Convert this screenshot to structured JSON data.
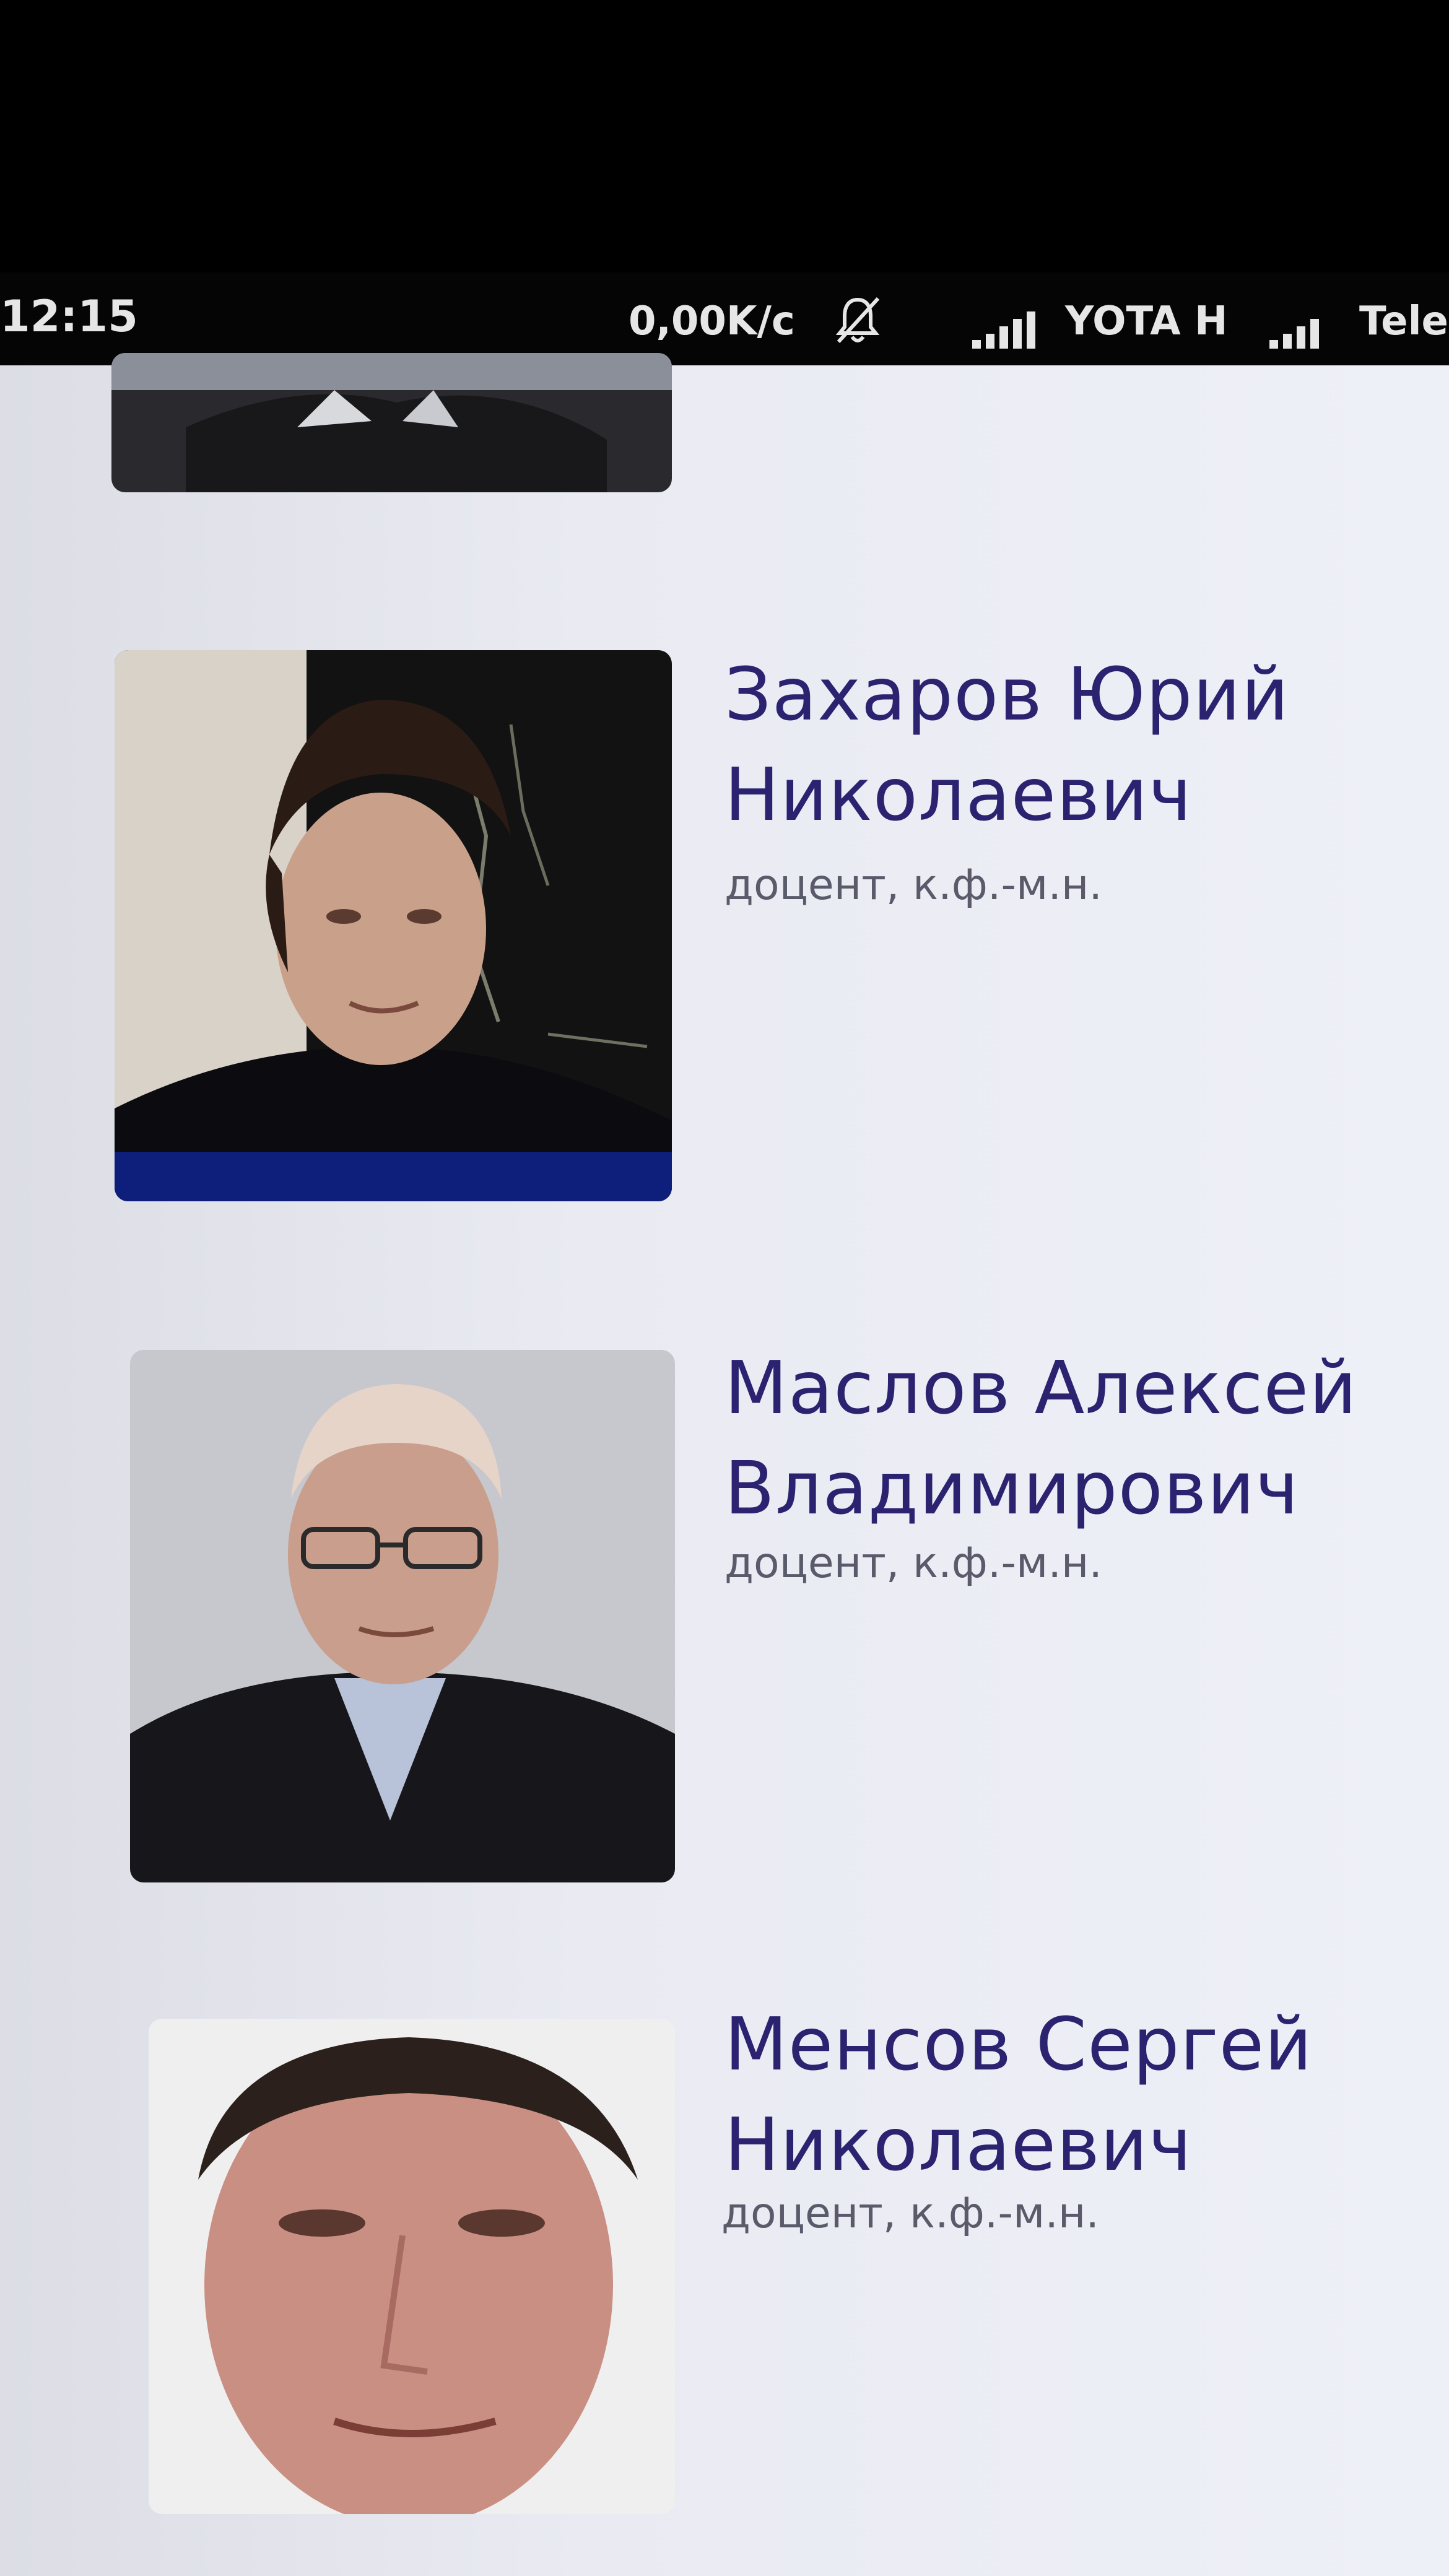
{
  "status_bar": {
    "time": "12:15",
    "net_speed": "0,00K/c",
    "notifications_icon": "bell-off-icon",
    "signal_icon": "signal-bars-icon",
    "carrier_1": "YOTA H",
    "carrier_2": "Tele"
  },
  "staff": [
    {
      "name_line1": "",
      "name_line2": "",
      "title": "",
      "photo": "person-photo"
    },
    {
      "name_line1": "Захаров Юрий",
      "name_line2": "Николаевич",
      "title": "доцент, к.ф.-м.н.",
      "photo": "person-photo"
    },
    {
      "name_line1": "Маслов Алексей",
      "name_line2": "Владимирович",
      "title": "доцент, к.ф.-м.н.",
      "photo": "person-photo"
    },
    {
      "name_line1": "Менсов Сергей",
      "name_line2": "Николаевич",
      "title": "доцент, к.ф.-м.н.",
      "photo": "person-photo"
    }
  ],
  "colors": {
    "name": "#2b2370",
    "title": "#5a5a6a",
    "background": "#e9eaf2"
  }
}
